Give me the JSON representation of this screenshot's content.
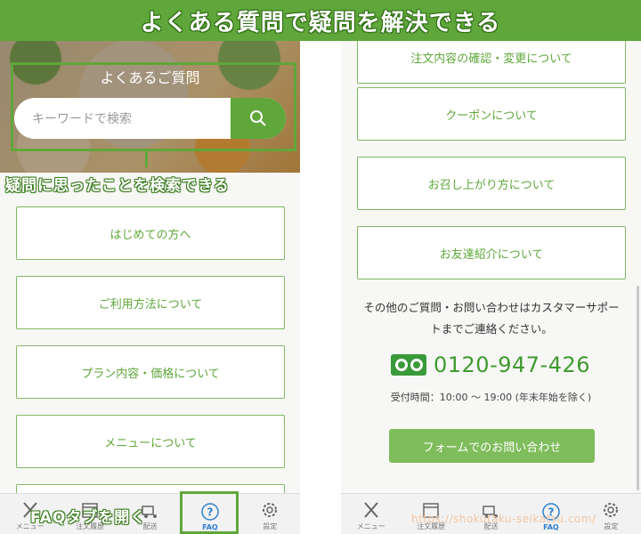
{
  "banner": {
    "title": "よくある質問で疑問を解決できる"
  },
  "left": {
    "hero_title": "よくあるご質問",
    "search": {
      "placeholder": "キーワードで検索"
    },
    "annotation_search": "疑問に思ったことを検索できる",
    "annotation_tab": "FAQタブを開く",
    "faq_items": [
      "はじめての方へ",
      "ご利用方法について",
      "プラン内容・価格について",
      "メニューについて"
    ],
    "tabs": [
      "メニュー",
      "注文履歴",
      "配送",
      "FAQ",
      "設定"
    ]
  },
  "right": {
    "faq_items": [
      "注文内容の確認・変更について",
      "クーポンについて",
      "お召し上がり方について",
      "お友達紹介について"
    ],
    "contact_line1": "その他のご質問・お問い合わせはカスタマーサポー",
    "contact_line2": "トまでご連絡ください。",
    "phone_number": "0120-947-426",
    "hours": "受付時間：10:00 〜 19:00 (年末年始を除く)",
    "form_button": "フォームでのお問い合わせ",
    "tabs": [
      "メニュー",
      "注文履歴",
      "配送",
      "FAQ",
      "設定"
    ]
  },
  "watermark": "https://shokutaku-seikatsu.com/",
  "colors": {
    "accent": "#5fa73a",
    "active_tab": "#2f7fd0"
  }
}
